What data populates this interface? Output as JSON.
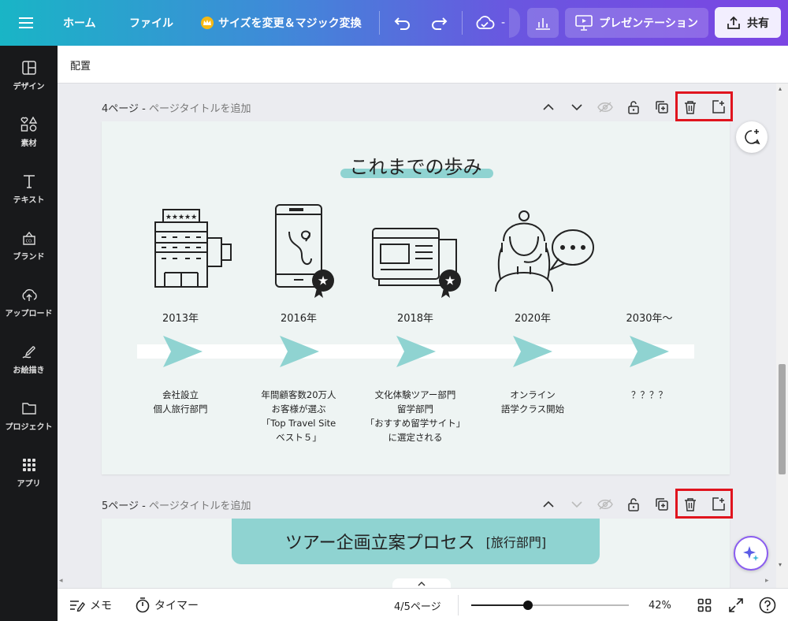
{
  "topbar": {
    "home": "ホーム",
    "file": "ファイル",
    "resize": "サイズを変更＆マジック変換",
    "present": "プレゼンテーション",
    "share": "共有",
    "cloud_dash": "-"
  },
  "sidebar": {
    "items": [
      {
        "label": "デザイン",
        "icon": "layout-icon"
      },
      {
        "label": "素材",
        "icon": "shapes-icon"
      },
      {
        "label": "テキスト",
        "icon": "text-icon"
      },
      {
        "label": "ブランド",
        "icon": "brand-icon"
      },
      {
        "label": "アップロード",
        "icon": "upload-icon"
      },
      {
        "label": "お絵描き",
        "icon": "draw-icon"
      },
      {
        "label": "プロジェクト",
        "icon": "folder-icon"
      },
      {
        "label": "アプリ",
        "icon": "apps-icon"
      }
    ]
  },
  "subheader": {
    "title": "配置"
  },
  "page4": {
    "label": "4ページ - ",
    "title_placeholder": "ページタイトルを追加",
    "slide_title": "これまでの歩み",
    "milestones": [
      {
        "year": "2013年",
        "desc": "会社設立\n個人旅行部門"
      },
      {
        "year": "2016年",
        "desc": "年間顧客数20万人\nお客様が選ぶ\n「Top Travel Site\nベスト５」"
      },
      {
        "year": "2018年",
        "desc": "文化体験ツアー部門\n留学部門\n「おすすめ留学サイト」\nに選定される"
      },
      {
        "year": "2020年",
        "desc": "オンライン\n語学クラス開始"
      },
      {
        "year": "2030年～",
        "desc": "？？？？"
      }
    ]
  },
  "page5": {
    "label": "5ページ - ",
    "title_placeholder": "ページタイトルを追加",
    "slide_title": "ツアー企画立案プロセス",
    "slide_subtitle": "[旅行部門]"
  },
  "bottombar": {
    "notes": "メモ",
    "timer": "タイマー",
    "page_indicator": "4/5ページ",
    "zoom": "42%",
    "zoom_fraction": 0.42
  },
  "colors": {
    "accent_teal": "#8fd3d1",
    "slide_bg": "#eef4f3",
    "highlight_red": "#e0141e"
  }
}
